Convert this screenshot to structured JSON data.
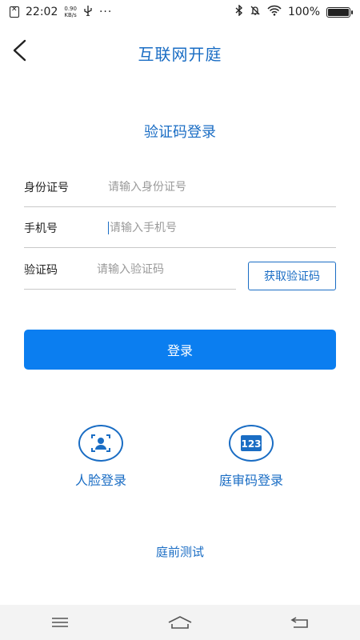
{
  "status_bar": {
    "time": "22:02",
    "speed_value": "0.90",
    "speed_unit": "KB/s",
    "battery": "100%"
  },
  "header": {
    "title": "互联网开庭"
  },
  "section_title": "验证码登录",
  "form": {
    "id_label": "身份证号",
    "id_placeholder": "请输入身份证号",
    "phone_label": "手机号",
    "phone_placeholder": "请输入手机号",
    "code_label": "验证码",
    "code_placeholder": "请输入验证码",
    "get_code_label": "获取验证码"
  },
  "login_button": "登录",
  "alt_logins": {
    "face": "人脸登录",
    "court_code": "庭审码登录"
  },
  "pretest_link": "庭前测试",
  "colors": {
    "accent": "#1a6dc4",
    "button": "#0b7ef0"
  }
}
